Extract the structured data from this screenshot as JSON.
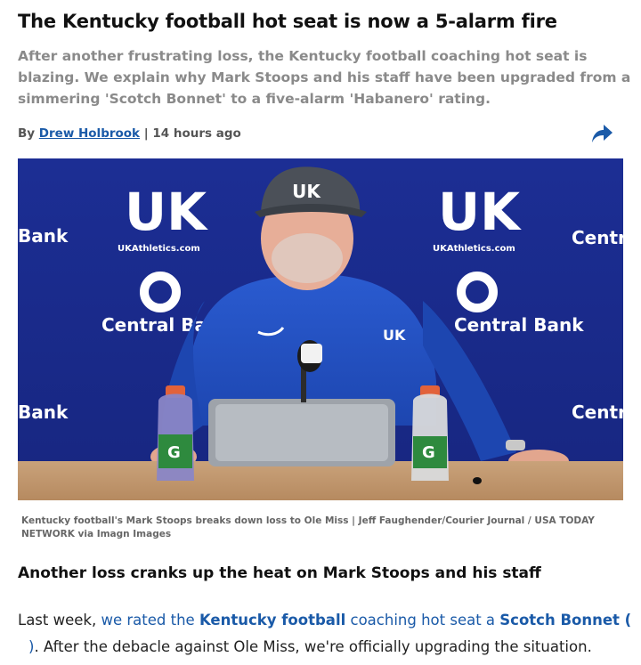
{
  "article": {
    "headline": "The Kentucky football hot seat is now a 5-alarm fire",
    "dek": "After another frustrating loss, the Kentucky football coaching hot seat is blazing. We explain why Mark Stoops and his staff have been upgraded from a simmering 'Scotch Bonnet' to a five-alarm 'Habanero' rating.",
    "byline_prefix": "By",
    "author": "Drew Holbrook",
    "separator": "|",
    "timestamp": "14 hours ago",
    "share_icon": "share-arrow-icon",
    "caption": "Kentucky football's Mark Stoops breaks down loss to Ole Miss | Jeff Faughender/Courier Journal / USA TODAY NETWORK via Imagn Images",
    "subhead": "Another loss cranks up the heat on Mark Stoops and his staff",
    "body": {
      "p1_start": "Last week,",
      "p1_link1": "we rated the",
      "p1_link2": "Kentucky football",
      "p1_link3": "coaching hot seat a",
      "p1_link4": "Scotch Bonnet (",
      "p1_link5": ")",
      "p1_end": ". After the debacle against Ole Miss, we're officially upgrading the situation."
    }
  },
  "photo": {
    "backdrop_logos": [
      "UK",
      "UKAthletics.com",
      "Central Bank"
    ],
    "cap_logo": "UK",
    "shirt_logo": "UK",
    "bottle_letter": "G"
  },
  "colors": {
    "link": "#1a5aa8",
    "backdrop": "#1a2b8a",
    "dek": "#8a8a8a"
  }
}
